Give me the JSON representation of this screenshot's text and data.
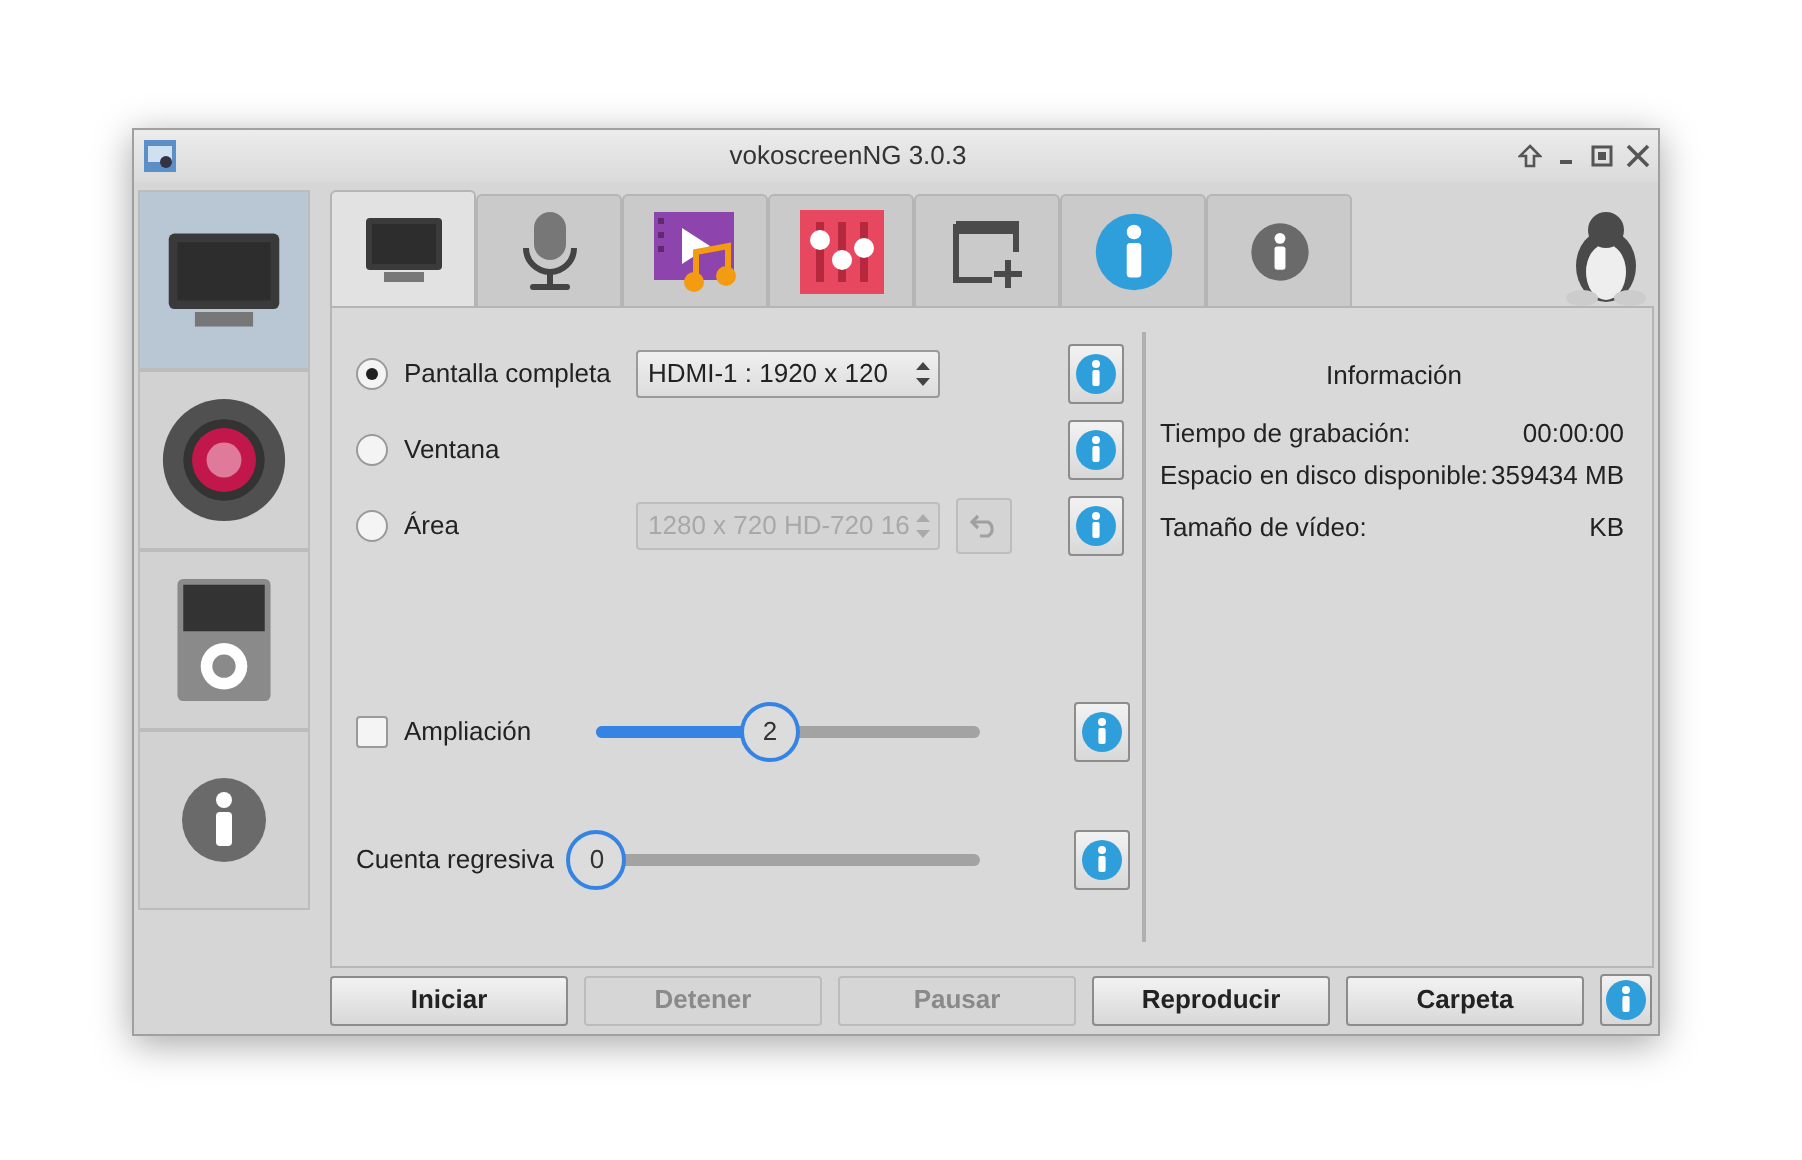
{
  "window": {
    "title": "vokoscreenNG 3.0.3"
  },
  "side_tabs": [
    {
      "kind": "screen",
      "selected": true
    },
    {
      "kind": "record",
      "selected": false
    },
    {
      "kind": "player",
      "selected": false
    },
    {
      "kind": "info",
      "selected": false
    }
  ],
  "top_tabs": [
    {
      "kind": "screen",
      "selected": true
    },
    {
      "kind": "mic",
      "selected": false
    },
    {
      "kind": "video",
      "selected": false
    },
    {
      "kind": "mixer",
      "selected": false
    },
    {
      "kind": "window-add",
      "selected": false
    },
    {
      "kind": "info-blue",
      "selected": false
    },
    {
      "kind": "info-grey",
      "selected": false
    }
  ],
  "capture": [
    {
      "label": "Pantalla completa",
      "selected": true,
      "combo": {
        "value": "HDMI-1 :  1920 x 120",
        "disabled": false
      }
    },
    {
      "label": "Ventana",
      "selected": false
    },
    {
      "label": "Área",
      "selected": false,
      "combo": {
        "value": "1280 x 720 HD-720 16",
        "disabled": true
      },
      "reset": {
        "disabled": true
      }
    }
  ],
  "magnifier": {
    "label": "Ampliación",
    "checked": false,
    "value": "2",
    "level": 0.5
  },
  "countdown": {
    "label": "Cuenta regresiva",
    "value": "0",
    "level": 0
  },
  "info": {
    "title": "Información",
    "rows": [
      {
        "label": "Tiempo de grabación:",
        "value": "00:00:00"
      },
      {
        "label": "Espacio en disco disponible:",
        "value": "359434  MB"
      },
      {
        "label": "Tamaño de vídeo:",
        "value": "KB"
      }
    ]
  },
  "buttons": [
    {
      "label": "Iniciar",
      "disabled": false
    },
    {
      "label": "Detener",
      "disabled": true
    },
    {
      "label": "Pausar",
      "disabled": true
    },
    {
      "label": "Reproducir",
      "disabled": false
    },
    {
      "label": "Carpeta",
      "disabled": false
    }
  ]
}
